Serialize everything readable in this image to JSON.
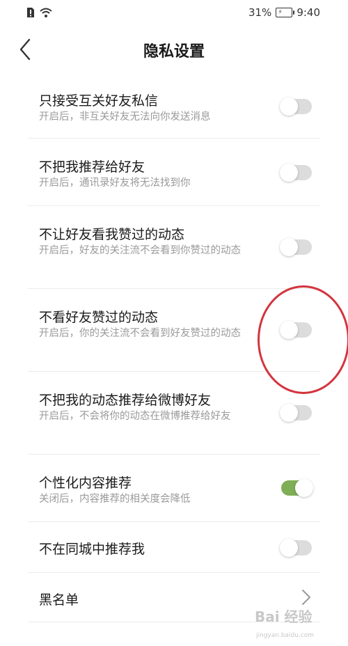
{
  "status": {
    "battery": "31%",
    "time": "9:40"
  },
  "header": {
    "title": "隐私设置"
  },
  "settings": [
    {
      "title": "只接受互关好友私信",
      "desc": "开启后，非互关好友无法向你发送消息",
      "toggle": "off"
    },
    {
      "title": "不把我推荐给好友",
      "desc": "开启后，通讯录好友将无法找到你",
      "toggle": "off"
    },
    {
      "title": "不让好友看我赞过的动态",
      "desc": "开启后，好友的关注流不会看到你赞过的动态",
      "toggle": "off"
    },
    {
      "title": "不看好友赞过的动态",
      "desc": "开启后，你的关注流不会看到好友赞过的动态",
      "toggle": "off"
    },
    {
      "title": "不把我的动态推荐给微博好友",
      "desc": "开启后，不会将你的动态在微博推荐给好友",
      "toggle": "off"
    },
    {
      "title": "个性化内容推荐",
      "desc": "关闭后，内容推荐的相关度会降低",
      "toggle": "on"
    },
    {
      "title": "不在同城中推荐我",
      "desc": "",
      "toggle": "off"
    },
    {
      "title": "黑名单",
      "desc": "",
      "toggle": null
    }
  ],
  "watermark": {
    "text": "Bai 经验",
    "url": "jingyan.baidu.com"
  },
  "colors": {
    "toggle_on": "#7fae57",
    "toggle_off": "#dcdcdc",
    "highlight_circle": "#d3343e"
  }
}
